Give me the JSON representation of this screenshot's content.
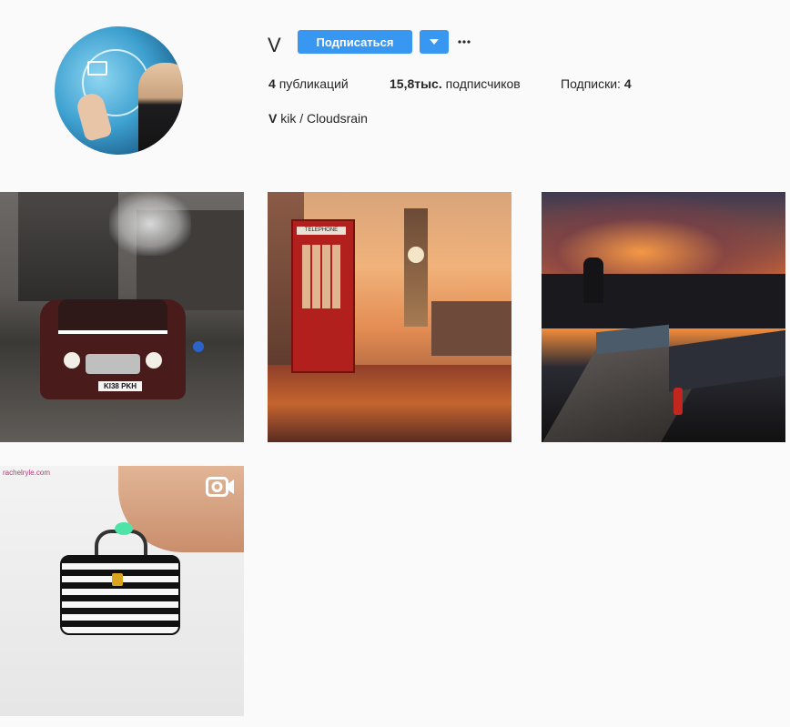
{
  "profile": {
    "username": "V",
    "follow_label": "Подписаться",
    "posts_count": "4",
    "posts_label": "публикаций",
    "followers_count": "15,8тыс.",
    "followers_label": "подписчиков",
    "following_label": "Подписки:",
    "following_count": "4",
    "bio_name": "V",
    "bio_text": "kik / Cloudsrain"
  },
  "icons": {
    "dropdown": "triangle-down-icon",
    "more": "ellipsis-icon",
    "video": "video-camera-icon"
  },
  "colors": {
    "accent": "#3897f0",
    "background": "#fafafa",
    "text": "#262626"
  },
  "posts": [
    {
      "plate": "KI38 PKH"
    },
    {
      "sign": "TELEPHONE"
    },
    {},
    {
      "watermark": "rachelryle.com"
    }
  ]
}
